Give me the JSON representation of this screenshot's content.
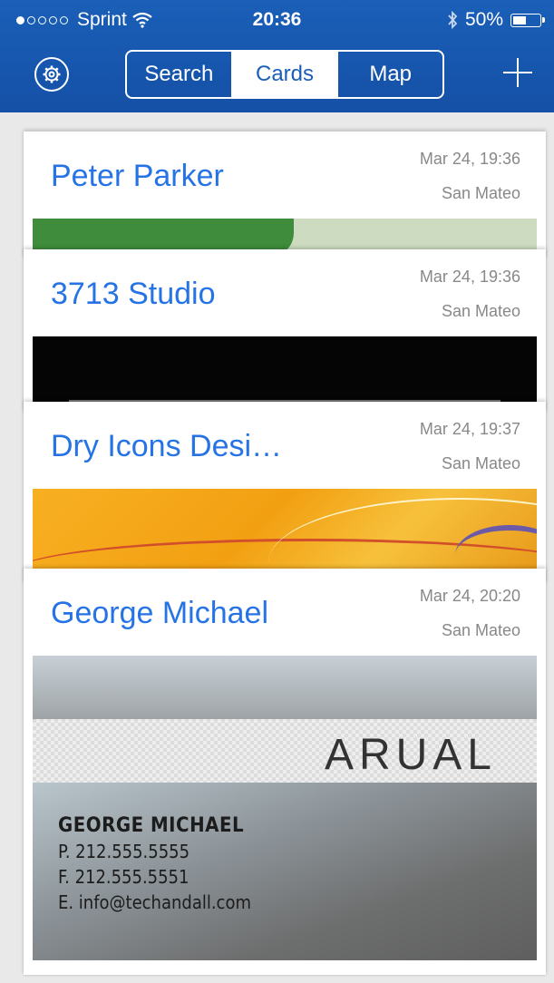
{
  "status_bar": {
    "carrier": "Sprint",
    "time": "20:36",
    "battery": "50%",
    "battery_level": 0.5,
    "signal_bars_filled": 1,
    "signal_bars_total": 5
  },
  "nav": {
    "segments": [
      {
        "label": "Search",
        "active": false
      },
      {
        "label": "Cards",
        "active": true
      },
      {
        "label": "Map",
        "active": false
      }
    ],
    "accent_color": "#1a5fb8"
  },
  "cards": [
    {
      "name": "Peter Parker",
      "date": "Mar 24, 19:36",
      "location": "San Mateo"
    },
    {
      "name": "3713 Studio",
      "date": "Mar 24, 19:36",
      "location": "San Mateo"
    },
    {
      "name": "Dry Icons Desi…",
      "date": "Mar 24, 19:37",
      "location": "San Mateo"
    },
    {
      "name": "George Michael",
      "date": "Mar 24, 20:20",
      "location": "San Mateo"
    }
  ],
  "business_card": {
    "logo": "ARUAL",
    "name": "GEORGE MICHAEL",
    "phone": "P.  212.555.5555",
    "fax": "F.   212.555.5551",
    "email": "E.   info@techandall.com"
  }
}
